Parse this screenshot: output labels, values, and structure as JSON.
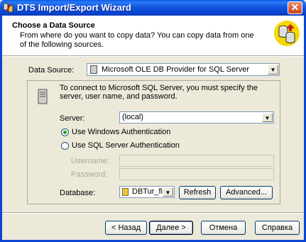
{
  "window": {
    "title": "DTS Import/Export Wizard",
    "close_label": "✕"
  },
  "header": {
    "title": "Choose a Data Source",
    "description": "From where do you want to copy data? You can copy data from one of the following sources."
  },
  "data_source": {
    "label": "Data Source:",
    "value": "Microsoft OLE DB Provider for SQL Server"
  },
  "connection": {
    "info": "To connect to Microsoft SQL Server, you must specify the server, user name, and password.",
    "server_label": "Server:",
    "server_value": "(local)",
    "auth_windows_label": "Use Windows Authentication",
    "auth_sql_label": "Use SQL Server Authentication",
    "username_label": "Username:",
    "password_label": "Password:",
    "database_label": "Database:",
    "database_value": "DBTur_fin",
    "refresh_label": "Refresh",
    "advanced_label": "Advanced..."
  },
  "footer": {
    "back_label": "< Назад",
    "next_label": "Далее >",
    "cancel_label": "Отмена",
    "help_label": "Справка"
  },
  "colors": {
    "titlebar": "#0a46d3",
    "dialog_bg": "#ece9d8",
    "header_bg": "#ffffff",
    "radio_dot": "#21a121"
  },
  "state": {
    "selected_auth": "windows"
  }
}
